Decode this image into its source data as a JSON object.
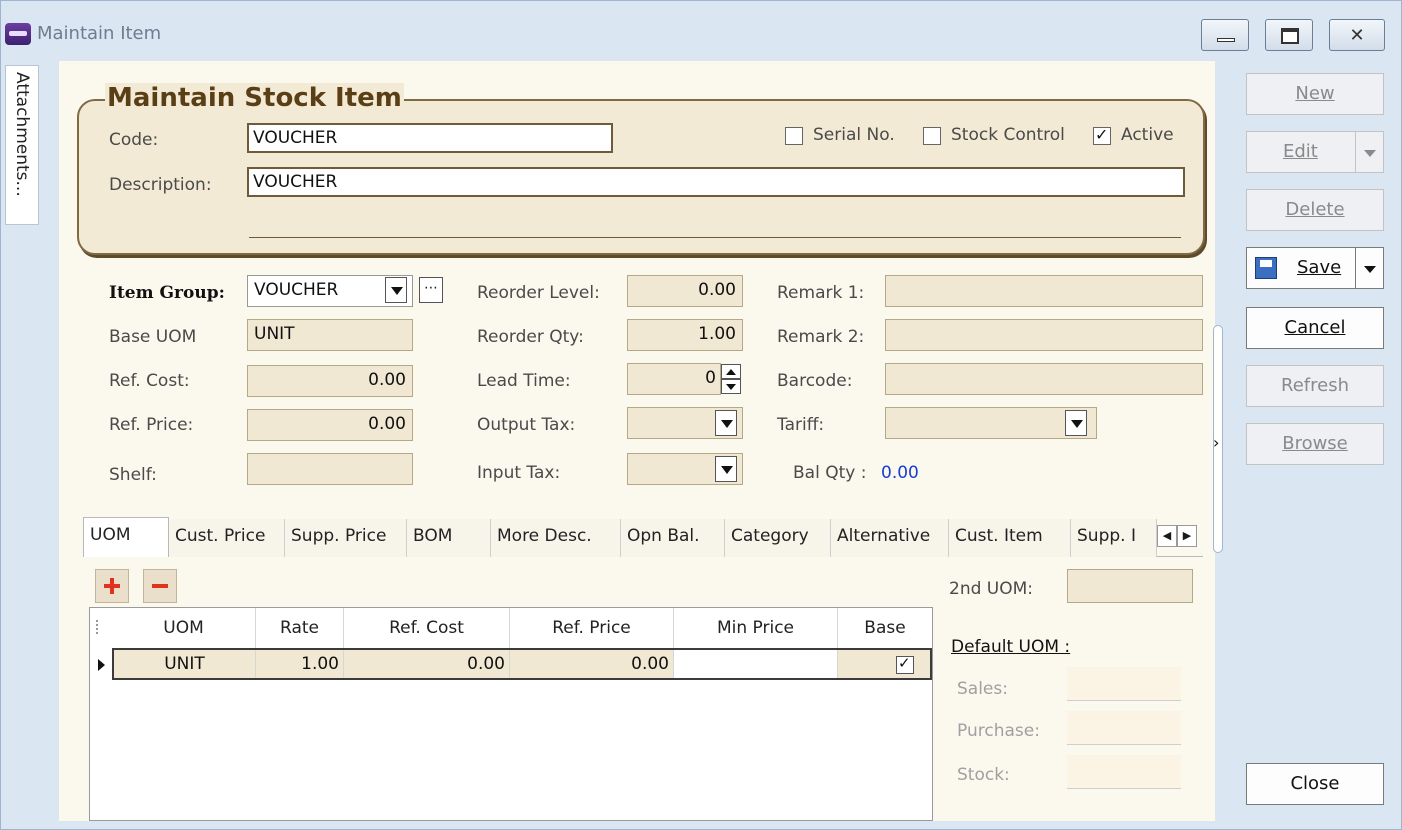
{
  "window": {
    "title": "Maintain Item"
  },
  "attachments_tab": "Attachments...",
  "header": {
    "group_title": "Maintain Stock Item",
    "code_label": "Code:",
    "code_value": "VOUCHER",
    "description_label": "Description:",
    "description_value": "VOUCHER",
    "serial_no": {
      "label": "Serial No.",
      "checked": false
    },
    "stock_control": {
      "label": "Stock Control",
      "checked": false
    },
    "active": {
      "label": "Active",
      "checked": true
    }
  },
  "fields": {
    "item_group_label": "Item Group:",
    "item_group_value": "VOUCHER",
    "base_uom_label": "Base UOM",
    "base_uom_value": "UNIT",
    "ref_cost_label": "Ref. Cost:",
    "ref_cost_value": "0.00",
    "ref_price_label": "Ref. Price:",
    "ref_price_value": "0.00",
    "shelf_label": "Shelf:",
    "shelf_value": "",
    "reorder_level_label": "Reorder Level:",
    "reorder_level_value": "0.00",
    "reorder_qty_label": "Reorder Qty:",
    "reorder_qty_value": "1.00",
    "lead_time_label": "Lead Time:",
    "lead_time_value": "0",
    "output_tax_label": "Output Tax:",
    "output_tax_value": "",
    "input_tax_label": "Input Tax:",
    "input_tax_value": "",
    "remark1_label": "Remark 1:",
    "remark1_value": "",
    "remark2_label": "Remark 2:",
    "remark2_value": "",
    "barcode_label": "Barcode:",
    "barcode_value": "",
    "tariff_label": "Tariff:",
    "tariff_value": "",
    "bal_qty_label": "Bal Qty :",
    "bal_qty_value": "0.00",
    "bal_qty_color": "#1a3bd6"
  },
  "tabs": [
    {
      "label": "UOM",
      "active": true
    },
    {
      "label": "Cust. Price"
    },
    {
      "label": "Supp. Price"
    },
    {
      "label": "BOM"
    },
    {
      "label": "More Desc."
    },
    {
      "label": "Opn Bal."
    },
    {
      "label": "Category"
    },
    {
      "label": "Alternative"
    },
    {
      "label": "Cust. Item"
    },
    {
      "label": "Supp. I"
    }
  ],
  "uom_grid": {
    "columns": [
      "UOM",
      "Rate",
      "Ref. Cost",
      "Ref. Price",
      "Min Price",
      "Base"
    ],
    "rows": [
      {
        "uom": "UNIT",
        "rate": "1.00",
        "ref_cost": "0.00",
        "ref_price": "0.00",
        "min_price": "",
        "base": true
      }
    ]
  },
  "uom_side": {
    "second_uom_label": "2nd UOM:",
    "second_uom_value": "",
    "default_uom_label": "Default UOM :",
    "sales_label": "Sales:",
    "purchase_label": "Purchase:",
    "stock_label": "Stock:"
  },
  "buttons": {
    "new": "New",
    "edit": "Edit",
    "delete": "Delete",
    "save": "Save",
    "cancel": "Cancel",
    "refresh": "Refresh",
    "browse": "Browse",
    "close": "Close"
  },
  "colors": {
    "accent_title": "#5a3e16",
    "field_bg": "#f1e8d3",
    "remove_add_icon": "#e0331c"
  }
}
